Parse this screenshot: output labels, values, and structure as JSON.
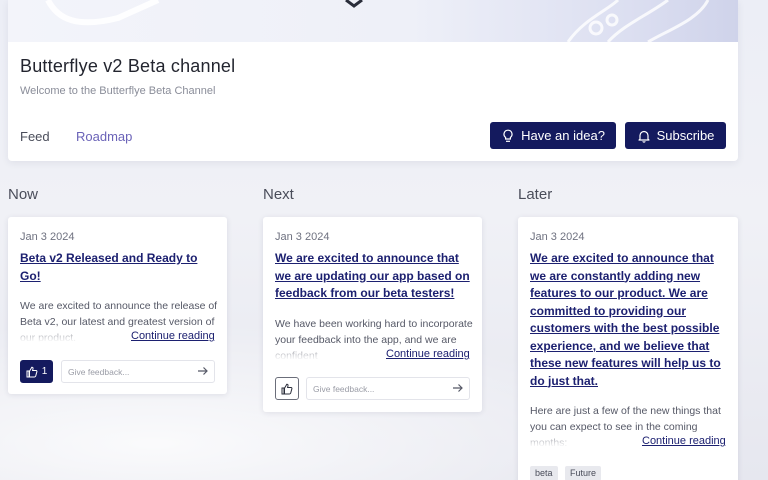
{
  "channel": {
    "title": "Butterflye v2 Beta channel",
    "subtitle": "Welcome to the Butterflye Beta Channel"
  },
  "nav": {
    "tabs": [
      {
        "label": "Feed",
        "active": false
      },
      {
        "label": "Roadmap",
        "active": true
      }
    ]
  },
  "actions": {
    "idea_label": "Have an idea?",
    "idea_icon": "lightbulb-icon",
    "subscribe_label": "Subscribe",
    "subscribe_icon": "bell-icon"
  },
  "columns": [
    {
      "title": "Now",
      "cards": [
        {
          "date": "Jan 3 2024",
          "title": "Beta v2 Released and Ready to Go!",
          "body": "We are excited to announce the release of Beta v2, our latest and greatest version of our product.",
          "continue_label": "Continue reading",
          "likes": "1",
          "feedback_placeholder": "Give feedback..."
        }
      ]
    },
    {
      "title": "Next",
      "cards": [
        {
          "date": "Jan 3 2024",
          "title": "We are excited to announce that we are updating our app based on feedback from our beta testers!",
          "body": "We have been working hard to incorporate your feedback into the app, and we are confident",
          "continue_label": "Continue reading",
          "feedback_placeholder": "Give feedback..."
        }
      ]
    },
    {
      "title": "Later",
      "cards": [
        {
          "date": "Jan 3 2024",
          "title": "We are excited to announce that we are constantly adding new features to our product. We are committed to providing our customers with the best possible experience, and we believe that these new features will help us to do just that.",
          "body": "Here are just a few of the new things that you can expect to see in the coming months:",
          "continue_label": "Continue reading",
          "tags": [
            "beta",
            "Future"
          ]
        }
      ]
    }
  ],
  "colors": {
    "accent": "#141a5e",
    "link": "#1c2070",
    "tab_active": "#6b63b8"
  }
}
